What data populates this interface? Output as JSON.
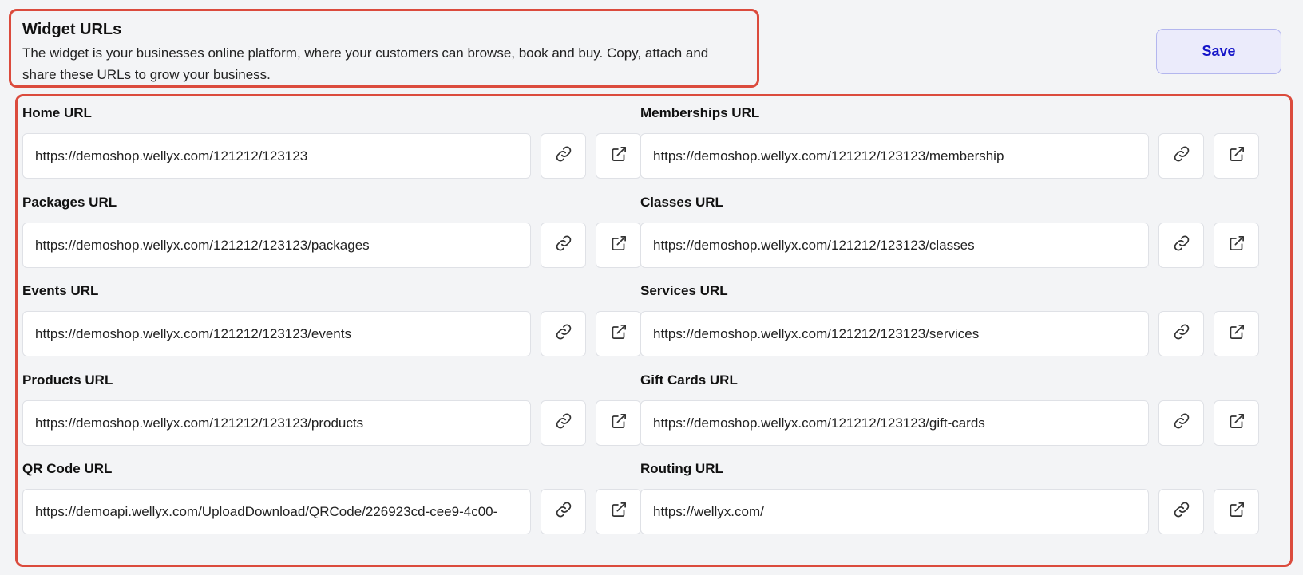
{
  "header": {
    "title": "Widget URLs",
    "description": "The widget is your businesses online platform, where your customers can browse, book and buy. Copy, attach and share these URLs to grow your business."
  },
  "toolbar": {
    "save_label": "Save"
  },
  "fields": [
    {
      "label": "Home URL",
      "value": "https://demoshop.wellyx.com/121212/123123"
    },
    {
      "label": "Memberships URL",
      "value": "https://demoshop.wellyx.com/121212/123123/membership"
    },
    {
      "label": "Packages URL",
      "value": "https://demoshop.wellyx.com/121212/123123/packages"
    },
    {
      "label": "Classes URL",
      "value": "https://demoshop.wellyx.com/121212/123123/classes"
    },
    {
      "label": "Events URL",
      "value": "https://demoshop.wellyx.com/121212/123123/events"
    },
    {
      "label": "Services URL",
      "value": "https://demoshop.wellyx.com/121212/123123/services"
    },
    {
      "label": "Products URL",
      "value": "https://demoshop.wellyx.com/121212/123123/products"
    },
    {
      "label": "Gift Cards URL",
      "value": "https://demoshop.wellyx.com/121212/123123/gift-cards"
    },
    {
      "label": "QR Code URL",
      "value": "https://demoapi.wellyx.com/UploadDownload/QRCode/226923cd-cee9-4c00-"
    },
    {
      "label": "Routing URL",
      "value": "https://wellyx.com/"
    }
  ],
  "icons": {
    "copy": "link-icon",
    "open": "external-link-icon"
  },
  "colors": {
    "highlight": "#db4b3d",
    "accent": "#1414c8",
    "save_bg": "#ebebfb"
  }
}
